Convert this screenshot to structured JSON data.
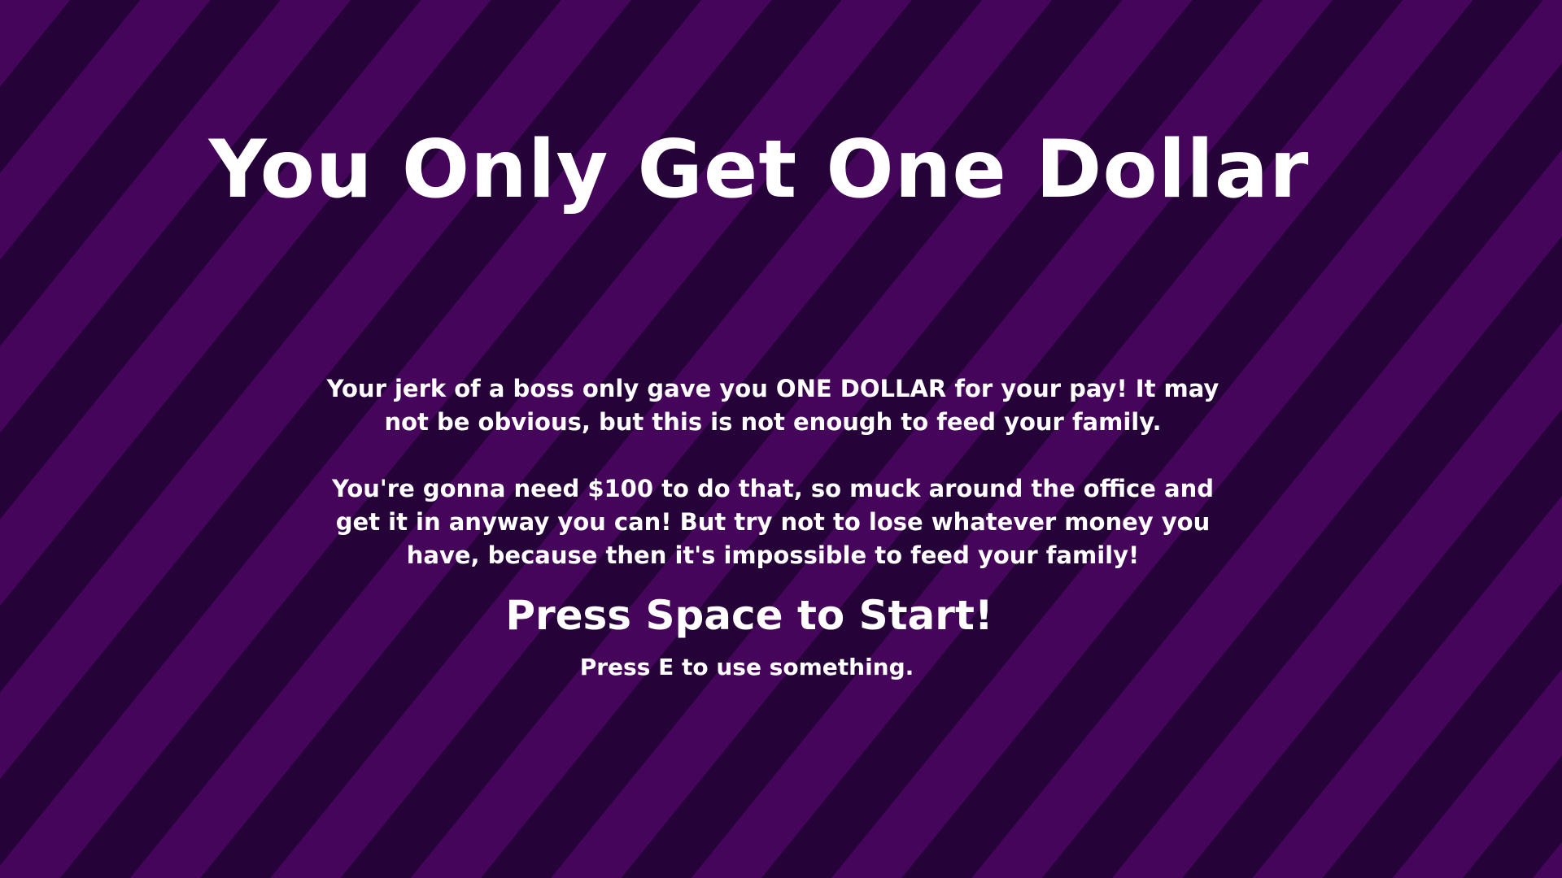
{
  "colors": {
    "stripe_light": "#45055a",
    "stripe_dark": "#250339",
    "text": "#ffffff"
  },
  "title_screen": {
    "title": "You Only Get One Dollar",
    "intro_paragraphs": [
      "Your jerk of a boss only gave you ONE DOLLAR for your pay! It may not be obvious, but this is not enough to feed your family.",
      "You're gonna need $100 to do that, so muck around the office and get it in anyway you can! But try not to lose whatever money you have, because then it's impossible to feed your family!"
    ],
    "start_prompt": "Press Space to Start!",
    "use_hint": "Press E to use something."
  }
}
